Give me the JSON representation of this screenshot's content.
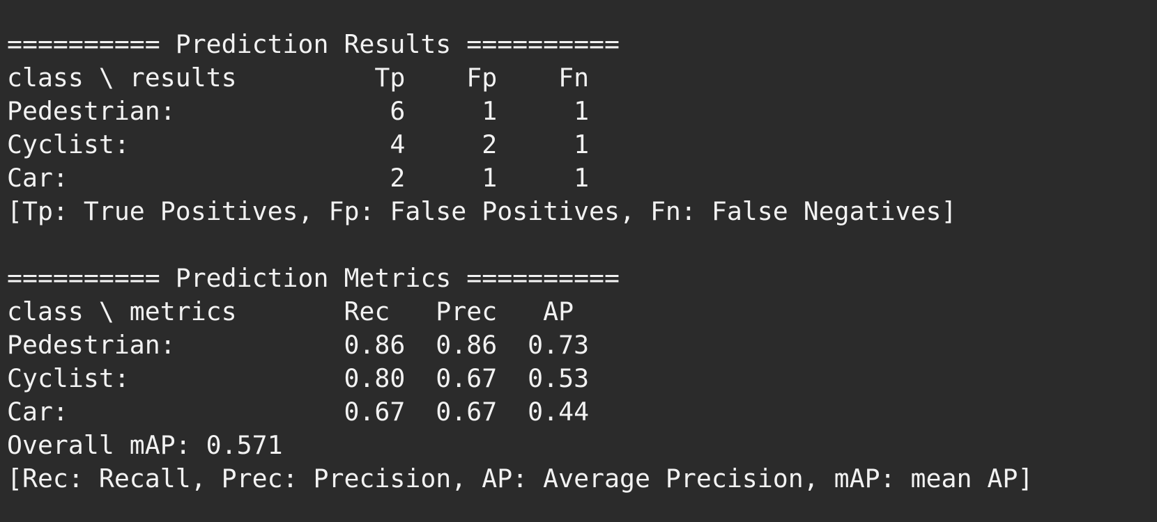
{
  "colors": {
    "background": "#2b2b2b",
    "foreground": "#f2f2f2"
  },
  "terminal": {
    "results_header": "========== Prediction Results ==========",
    "results_col_header": "class \\ results         Tp    Fp    Fn",
    "results_rows": [
      "Pedestrian:              6     1     1",
      "Cyclist:                 4     2     1",
      "Car:                     2     1     1"
    ],
    "results_legend": "[Tp: True Positives, Fp: False Positives, Fn: False Negatives]",
    "metrics_header": "========== Prediction Metrics ==========",
    "metrics_col_header": "class \\ metrics       Rec   Prec   AP",
    "metrics_rows": [
      "Pedestrian:           0.86  0.86  0.73",
      "Cyclist:              0.80  0.67  0.53",
      "Car:                  0.67  0.67  0.44"
    ],
    "overall_map": "Overall mAP: 0.571",
    "metrics_legend": "[Rec: Recall, Prec: Precision, AP: Average Precision, mAP: mean AP]"
  }
}
